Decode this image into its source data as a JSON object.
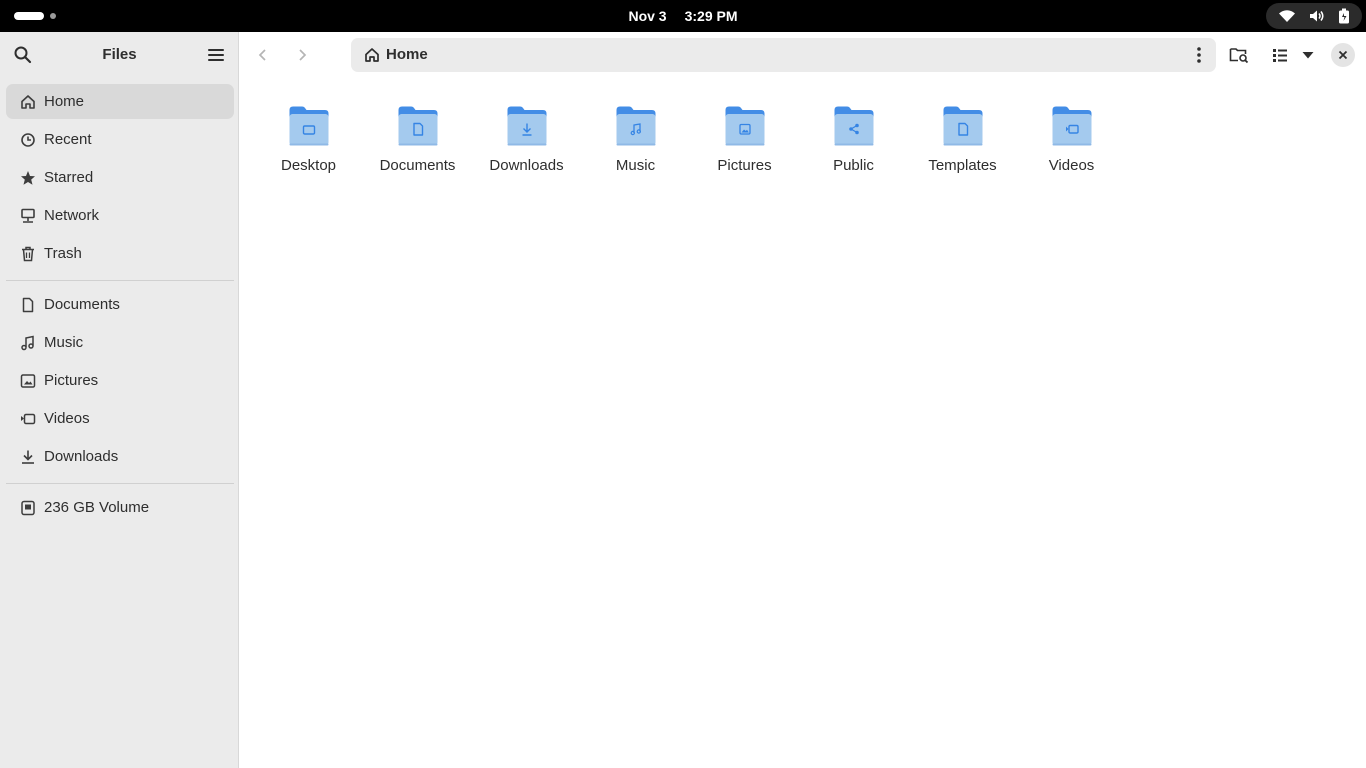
{
  "topbar": {
    "date": "Nov 3",
    "time": "3:29 PM",
    "status_icons": [
      "wifi-icon",
      "volume-icon",
      "battery-icon"
    ]
  },
  "sidebar": {
    "title": "Files",
    "places": [
      {
        "label": "Home",
        "icon": "home-icon",
        "active": true
      },
      {
        "label": "Recent",
        "icon": "clock-icon"
      },
      {
        "label": "Starred",
        "icon": "star-icon"
      },
      {
        "label": "Network",
        "icon": "network-icon"
      },
      {
        "label": "Trash",
        "icon": "trash-icon"
      }
    ],
    "bookmarks": [
      {
        "label": "Documents",
        "icon": "document-icon"
      },
      {
        "label": "Music",
        "icon": "music-icon"
      },
      {
        "label": "Pictures",
        "icon": "picture-icon"
      },
      {
        "label": "Videos",
        "icon": "video-icon"
      },
      {
        "label": "Downloads",
        "icon": "download-icon"
      }
    ],
    "devices": [
      {
        "label": "236 GB Volume",
        "icon": "drive-icon"
      }
    ]
  },
  "header": {
    "location": "Home"
  },
  "folders": [
    {
      "label": "Desktop",
      "icon": "desktop-folder-icon"
    },
    {
      "label": "Documents",
      "icon": "documents-folder-icon"
    },
    {
      "label": "Downloads",
      "icon": "downloads-folder-icon"
    },
    {
      "label": "Music",
      "icon": "music-folder-icon"
    },
    {
      "label": "Pictures",
      "icon": "pictures-folder-icon"
    },
    {
      "label": "Public",
      "icon": "public-folder-icon"
    },
    {
      "label": "Templates",
      "icon": "templates-folder-icon"
    },
    {
      "label": "Videos",
      "icon": "videos-folder-icon"
    }
  ],
  "colors": {
    "accent": "#3584e4",
    "folder_back": "#438de6",
    "folder_front": "#a4caee",
    "sidebar_bg": "#ebebeb"
  }
}
